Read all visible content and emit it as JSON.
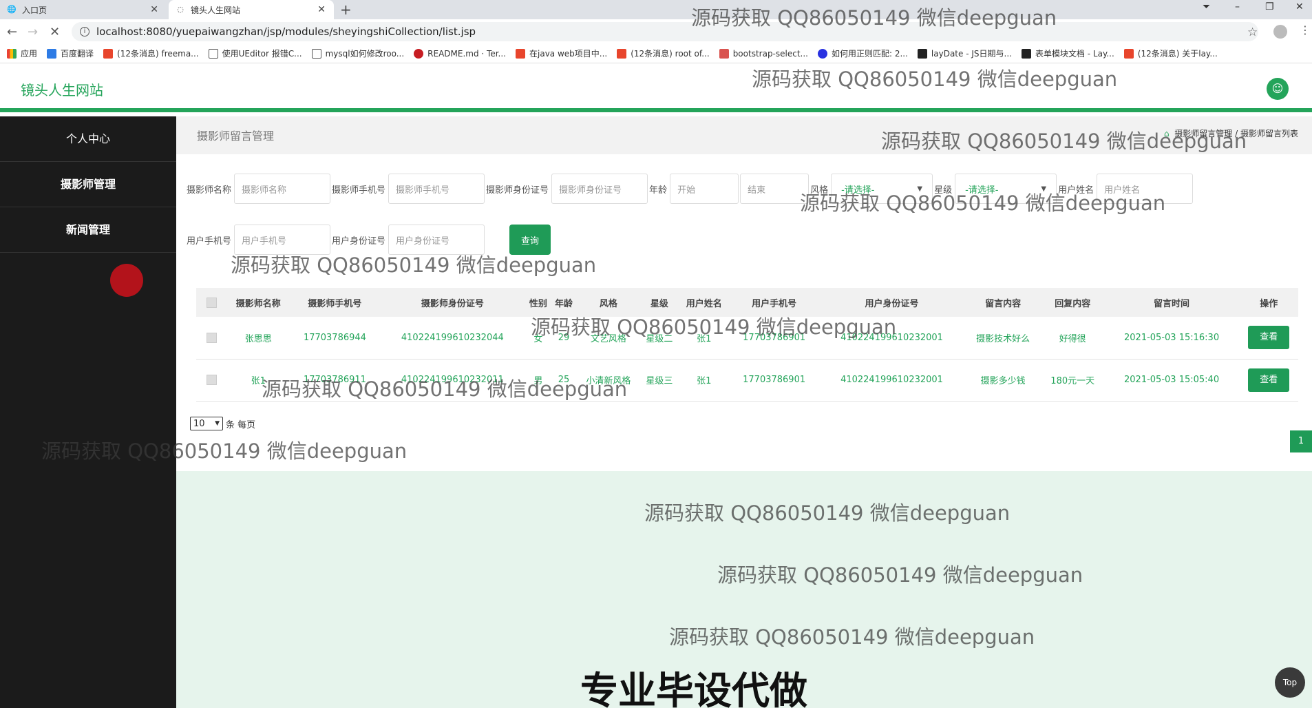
{
  "browser": {
    "tabs": [
      {
        "title": "入口页"
      },
      {
        "title": "镜头人生网站"
      }
    ],
    "url": "localhost:8080/yuepaiwangzhan/jsp/modules/sheyingshiCollection/list.jsp",
    "bookmarks": [
      "应用",
      "百度翻译",
      "(12条消息) freema...",
      "使用UEditor 报错C...",
      "mysql如何修改roo...",
      "README.md · Ter...",
      "在java web项目中...",
      "(12条消息) root of...",
      "bootstrap-select...",
      "如何用正则匹配: 2...",
      "layDate - JS日期与...",
      "表单模块文档 - Lay...",
      "(12条消息) 关于lay..."
    ]
  },
  "app": {
    "brand": "镜头人生网站",
    "sidebar": [
      "个人中心",
      "摄影师管理",
      "新闻管理"
    ],
    "page_title": "摄影师留言管理",
    "breadcrumb": [
      "摄影师留言管理",
      "摄影师留言列表"
    ]
  },
  "filters": {
    "row1": [
      {
        "label": "摄影师名称",
        "placeholder": "摄影师名称"
      },
      {
        "label": "摄影师手机号",
        "placeholder": "摄影师手机号"
      },
      {
        "label": "摄影师身份证号",
        "placeholder": "摄影师身份证号"
      }
    ],
    "age_label": "年龄",
    "age_start": "开始",
    "age_end": "结束",
    "style_label": "风格",
    "style_value": "-请选择-",
    "level_label": "星级",
    "level_value": "-请选择-",
    "user_name_label": "用户姓名",
    "user_name_placeholder": "用户姓名",
    "row2": [
      {
        "label": "用户手机号",
        "placeholder": "用户手机号"
      },
      {
        "label": "用户身份证号",
        "placeholder": "用户身份证号"
      }
    ],
    "search_label": "查询"
  },
  "table": {
    "headers": [
      "摄影师名称",
      "摄影师手机号",
      "摄影师身份证号",
      "性别",
      "年龄",
      "风格",
      "星级",
      "用户姓名",
      "用户手机号",
      "用户身份证号",
      "留言内容",
      "回复内容",
      "留言时间",
      "操作"
    ],
    "rows": [
      [
        "张思思",
        "17703786944",
        "410224199610232044",
        "女",
        "29",
        "文艺风格",
        "星级二",
        "张1",
        "17703786901",
        "410224199610232001",
        "摄影技术好么",
        "好得很",
        "2021-05-03 15:16:30",
        "查看"
      ],
      [
        "张1",
        "17703786911",
        "410224199610232011",
        "男",
        "25",
        "小清新风格",
        "星级三",
        "张1",
        "17703786901",
        "410224199610232001",
        "摄影多少钱",
        "180元一天",
        "2021-05-03 15:05:40",
        "查看"
      ]
    ]
  },
  "pagination": {
    "page_size": "10",
    "per_page_label": "条 每页",
    "current_page": "1"
  },
  "top_button": "Top",
  "watermark": "源码获取 QQ86050149 微信deepguan",
  "promo": "专业毕设代做"
}
